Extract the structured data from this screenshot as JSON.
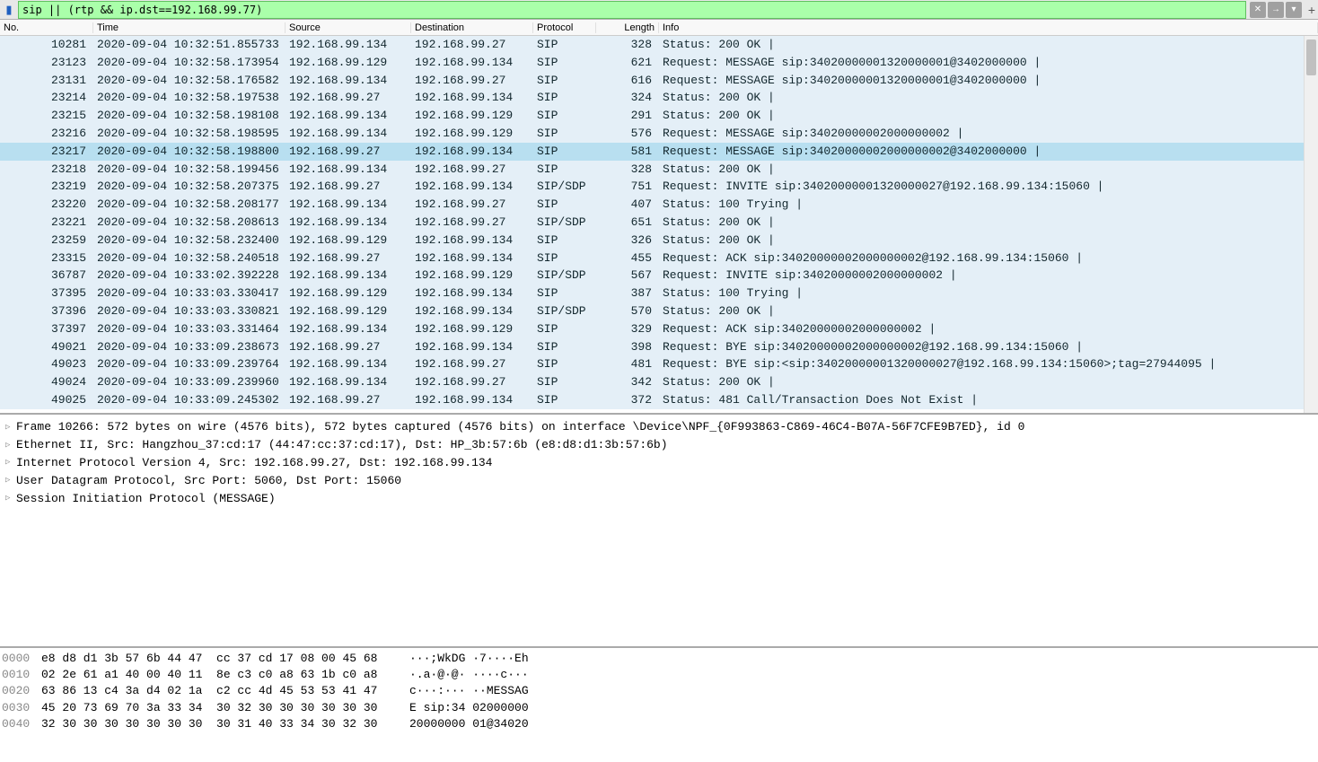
{
  "filter": {
    "value": "sip || (rtp && ip.dst==192.168.99.77)"
  },
  "columns": {
    "no": "No.",
    "time": "Time",
    "src": "Source",
    "dst": "Destination",
    "proto": "Protocol",
    "len": "Length",
    "info": "Info"
  },
  "packets": [
    {
      "no": "10281",
      "time": "2020-09-04 10:32:51.855733",
      "src": "192.168.99.134",
      "dst": "192.168.99.27",
      "proto": "SIP",
      "len": "328",
      "info": "Status: 200 OK | "
    },
    {
      "no": "23123",
      "time": "2020-09-04 10:32:58.173954",
      "src": "192.168.99.129",
      "dst": "192.168.99.134",
      "proto": "SIP",
      "len": "621",
      "info": "Request: MESSAGE sip:34020000001320000001@3402000000 | "
    },
    {
      "no": "23131",
      "time": "2020-09-04 10:32:58.176582",
      "src": "192.168.99.134",
      "dst": "192.168.99.27",
      "proto": "SIP",
      "len": "616",
      "info": "Request: MESSAGE sip:34020000001320000001@3402000000 | "
    },
    {
      "no": "23214",
      "time": "2020-09-04 10:32:58.197538",
      "src": "192.168.99.27",
      "dst": "192.168.99.134",
      "proto": "SIP",
      "len": "324",
      "info": "Status: 200 OK | "
    },
    {
      "no": "23215",
      "time": "2020-09-04 10:32:58.198108",
      "src": "192.168.99.134",
      "dst": "192.168.99.129",
      "proto": "SIP",
      "len": "291",
      "info": "Status: 200 OK | "
    },
    {
      "no": "23216",
      "time": "2020-09-04 10:32:58.198595",
      "src": "192.168.99.134",
      "dst": "192.168.99.129",
      "proto": "SIP",
      "len": "576",
      "info": "Request: MESSAGE sip:34020000002000000002 | "
    },
    {
      "no": "23217",
      "time": "2020-09-04 10:32:58.198800",
      "src": "192.168.99.27",
      "dst": "192.168.99.134",
      "proto": "SIP",
      "len": "581",
      "info": "Request: MESSAGE sip:34020000002000000002@3402000000 | ",
      "selected": true
    },
    {
      "no": "23218",
      "time": "2020-09-04 10:32:58.199456",
      "src": "192.168.99.134",
      "dst": "192.168.99.27",
      "proto": "SIP",
      "len": "328",
      "info": "Status: 200 OK | "
    },
    {
      "no": "23219",
      "time": "2020-09-04 10:32:58.207375",
      "src": "192.168.99.27",
      "dst": "192.168.99.134",
      "proto": "SIP/SDP",
      "len": "751",
      "info": "Request: INVITE sip:34020000001320000027@192.168.99.134:15060 | "
    },
    {
      "no": "23220",
      "time": "2020-09-04 10:32:58.208177",
      "src": "192.168.99.134",
      "dst": "192.168.99.27",
      "proto": "SIP",
      "len": "407",
      "info": "Status: 100 Trying | "
    },
    {
      "no": "23221",
      "time": "2020-09-04 10:32:58.208613",
      "src": "192.168.99.134",
      "dst": "192.168.99.27",
      "proto": "SIP/SDP",
      "len": "651",
      "info": "Status: 200 OK | "
    },
    {
      "no": "23259",
      "time": "2020-09-04 10:32:58.232400",
      "src": "192.168.99.129",
      "dst": "192.168.99.134",
      "proto": "SIP",
      "len": "326",
      "info": "Status: 200 OK | "
    },
    {
      "no": "23315",
      "time": "2020-09-04 10:32:58.240518",
      "src": "192.168.99.27",
      "dst": "192.168.99.134",
      "proto": "SIP",
      "len": "455",
      "info": "Request: ACK sip:34020000002000000002@192.168.99.134:15060 | "
    },
    {
      "no": "36787",
      "time": "2020-09-04 10:33:02.392228",
      "src": "192.168.99.134",
      "dst": "192.168.99.129",
      "proto": "SIP/SDP",
      "len": "567",
      "info": "Request: INVITE sip:34020000002000000002 | "
    },
    {
      "no": "37395",
      "time": "2020-09-04 10:33:03.330417",
      "src": "192.168.99.129",
      "dst": "192.168.99.134",
      "proto": "SIP",
      "len": "387",
      "info": "Status: 100 Trying | "
    },
    {
      "no": "37396",
      "time": "2020-09-04 10:33:03.330821",
      "src": "192.168.99.129",
      "dst": "192.168.99.134",
      "proto": "SIP/SDP",
      "len": "570",
      "info": "Status: 200 OK | "
    },
    {
      "no": "37397",
      "time": "2020-09-04 10:33:03.331464",
      "src": "192.168.99.134",
      "dst": "192.168.99.129",
      "proto": "SIP",
      "len": "329",
      "info": "Request: ACK sip:34020000002000000002 | "
    },
    {
      "no": "49021",
      "time": "2020-09-04 10:33:09.238673",
      "src": "192.168.99.27",
      "dst": "192.168.99.134",
      "proto": "SIP",
      "len": "398",
      "info": "Request: BYE sip:34020000002000000002@192.168.99.134:15060 | "
    },
    {
      "no": "49023",
      "time": "2020-09-04 10:33:09.239764",
      "src": "192.168.99.134",
      "dst": "192.168.99.27",
      "proto": "SIP",
      "len": "481",
      "info": "Request: BYE sip:<sip:34020000001320000027@192.168.99.134:15060>;tag=27944095 | "
    },
    {
      "no": "49024",
      "time": "2020-09-04 10:33:09.239960",
      "src": "192.168.99.134",
      "dst": "192.168.99.27",
      "proto": "SIP",
      "len": "342",
      "info": "Status: 200 OK | "
    },
    {
      "no": "49025",
      "time": "2020-09-04 10:33:09.245302",
      "src": "192.168.99.27",
      "dst": "192.168.99.134",
      "proto": "SIP",
      "len": "372",
      "info": "Status: 481 Call/Transaction Does Not Exist | "
    }
  ],
  "details": [
    "Frame 10266: 572 bytes on wire (4576 bits), 572 bytes captured (4576 bits) on interface \\Device\\NPF_{0F993863-C869-46C4-B07A-56F7CFE9B7ED}, id 0",
    "Ethernet II, Src: Hangzhou_37:cd:17 (44:47:cc:37:cd:17), Dst: HP_3b:57:6b (e8:d8:d1:3b:57:6b)",
    "Internet Protocol Version 4, Src: 192.168.99.27, Dst: 192.168.99.134",
    "User Datagram Protocol, Src Port: 5060, Dst Port: 15060",
    "Session Initiation Protocol (MESSAGE)"
  ],
  "hex": [
    {
      "off": "0000",
      "b": "e8 d8 d1 3b 57 6b 44 47  cc 37 cd 17 08 00 45 68",
      "a": "···;WkDG ·7····Eh"
    },
    {
      "off": "0010",
      "b": "02 2e 61 a1 40 00 40 11  8e c3 c0 a8 63 1b c0 a8",
      "a": "·.a·@·@· ····c···"
    },
    {
      "off": "0020",
      "b": "63 86 13 c4 3a d4 02 1a  c2 cc 4d 45 53 53 41 47",
      "a": "c···:··· ··MESSAG"
    },
    {
      "off": "0030",
      "b": "45 20 73 69 70 3a 33 34  30 32 30 30 30 30 30 30",
      "a": "E sip:34 02000000"
    },
    {
      "off": "0040",
      "b": "32 30 30 30 30 30 30 30  30 31 40 33 34 30 32 30",
      "a": "20000000 01@34020"
    }
  ]
}
